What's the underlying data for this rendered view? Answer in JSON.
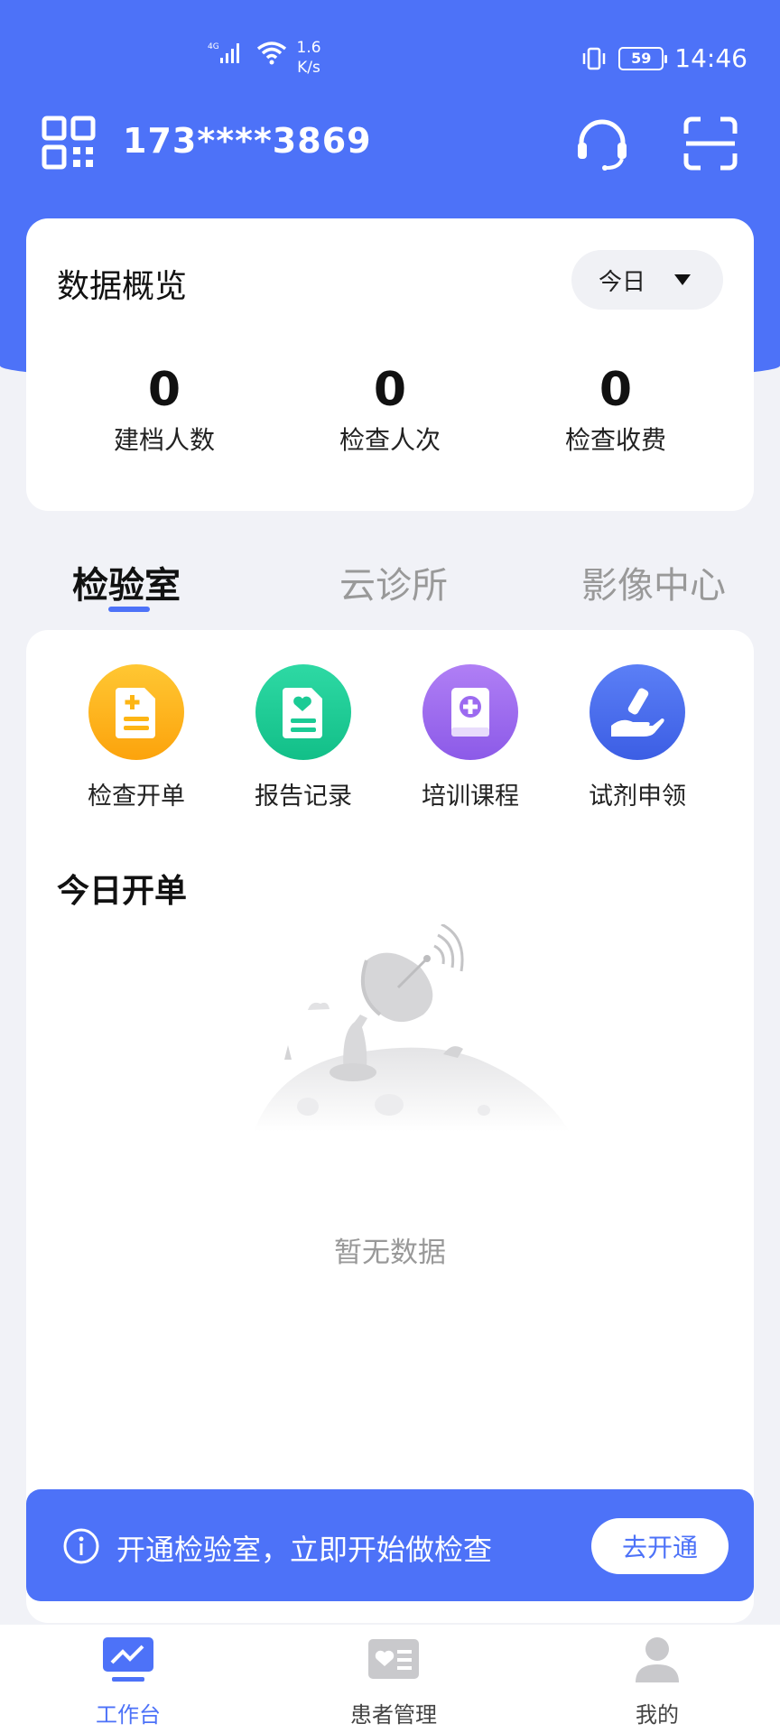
{
  "status_bar": {
    "network": "4G",
    "speed_value": "1.6",
    "speed_unit": "K/s",
    "battery": "59",
    "time": "14:46"
  },
  "header": {
    "phone": "173****3869"
  },
  "overview": {
    "title": "数据概览",
    "date_filter": "今日",
    "stats": [
      {
        "value": "0",
        "label": "建档人数"
      },
      {
        "value": "0",
        "label": "检查人次"
      },
      {
        "value": "0",
        "label": "检查收费"
      }
    ]
  },
  "tabs": [
    {
      "label": "检验室",
      "active": true
    },
    {
      "label": "云诊所",
      "active": false
    },
    {
      "label": "影像中心",
      "active": false
    }
  ],
  "functions": [
    {
      "label": "检查开单",
      "icon": "document-plus-icon",
      "color": "#fdb514"
    },
    {
      "label": "报告记录",
      "icon": "heart-document-icon",
      "color": "#1bcb95"
    },
    {
      "label": "培训课程",
      "icon": "medical-book-icon",
      "color": "#9c6af0"
    },
    {
      "label": "试剂申领",
      "icon": "test-tube-hand-icon",
      "color": "#4b6fee"
    }
  ],
  "today_orders": {
    "title": "今日开单",
    "empty_text": "暂无数据"
  },
  "banner": {
    "text": "开通检验室，立即开始做检查",
    "button": "去开通"
  },
  "bottom_nav": [
    {
      "label": "工作台",
      "icon": "dashboard-icon",
      "active": true
    },
    {
      "label": "患者管理",
      "icon": "patient-card-icon",
      "active": false
    },
    {
      "label": "我的",
      "icon": "user-icon",
      "active": false
    }
  ],
  "colors": {
    "primary": "#4d72f8",
    "background": "#f1f2f7"
  }
}
